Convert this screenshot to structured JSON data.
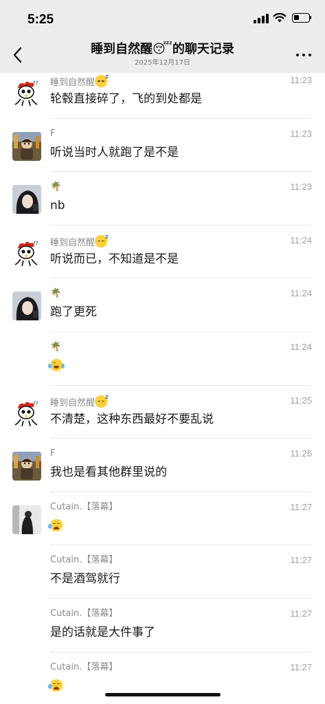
{
  "status_bar": {
    "time": "5:25"
  },
  "header": {
    "title": "睡到自然醒😴的聊天记录",
    "subtitle": "2025年12月17日"
  },
  "icons": {
    "back": "chevron-left-icon",
    "more": "more-dots-icon"
  },
  "messages": [
    {
      "sender": "睡到自然醒",
      "sender_emoji": "sleepy",
      "time": "11:23",
      "text": "轮毂直接碎了，飞的到处都是",
      "avatar": "rooster"
    },
    {
      "sender": "F",
      "time": "11:23",
      "text": "听说当时人就跑了是不是",
      "avatar": "doll"
    },
    {
      "sender": "🌴",
      "time": "11:23",
      "text": "nb",
      "avatar": "girl"
    },
    {
      "sender": "睡到自然醒",
      "sender_emoji": "sleepy",
      "time": "11:24",
      "text": "听说而已，不知道是不是",
      "avatar": "rooster"
    },
    {
      "sender": "🌴",
      "time": "11:24",
      "text": "跑了更死",
      "avatar": "girl"
    },
    {
      "sender": "🌴",
      "time": "11:24",
      "text": "",
      "text_emoji": "laugh",
      "avatar": ""
    },
    {
      "sender": "睡到自然醒",
      "sender_emoji": "sleepy",
      "time": "11:25",
      "text": "不清楚，这种东西最好不要乱说",
      "avatar": "rooster"
    },
    {
      "sender": "F",
      "time": "11:26",
      "text": "我也是看其他群里说的",
      "avatar": "doll"
    },
    {
      "sender": "Cutain.【落幕】",
      "time": "11:27",
      "text": "",
      "text_emoji": "cry",
      "avatar": "dark"
    },
    {
      "sender": "Cutain.【落幕】",
      "time": "11:27",
      "text": "不是酒驾就行",
      "avatar": ""
    },
    {
      "sender": "Cutain.【落幕】",
      "time": "11:27",
      "text": "是的话就是大件事了",
      "avatar": ""
    },
    {
      "sender": "Cutain.【落幕】",
      "time": "11:27",
      "text": "",
      "text_emoji": "cry",
      "avatar": ""
    }
  ]
}
